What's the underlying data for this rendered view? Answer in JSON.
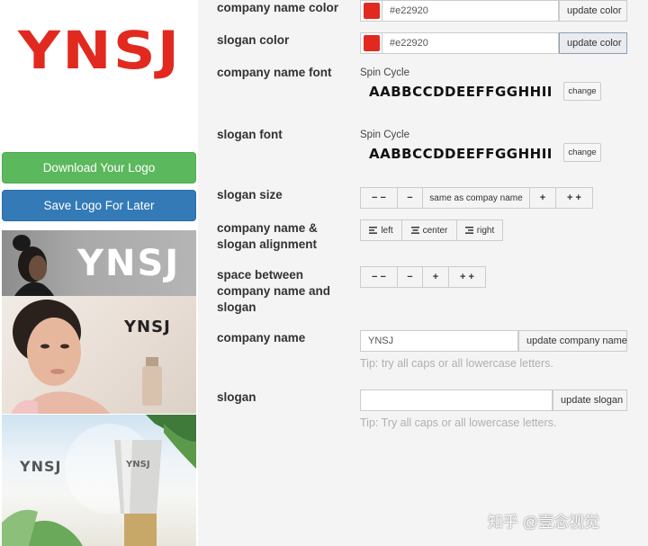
{
  "logo": {
    "text": "YNSJ",
    "color": "#e22920"
  },
  "left_buttons": {
    "download": "Download Your Logo",
    "save": "Save Logo For Later"
  },
  "mockups": [
    {
      "logo_text": "YNSJ"
    },
    {
      "logo_text": "YNSJ"
    },
    {
      "logo_text": "YNSJ",
      "label_text": "YNSJ"
    }
  ],
  "settings": {
    "company_name_color": {
      "label": "company name color",
      "value": "#e22920",
      "button": "update color"
    },
    "slogan_color": {
      "label": "slogan color",
      "value": "#e22920",
      "button": "update color"
    },
    "company_name_font": {
      "label": "company name font",
      "font_name": "Spin Cycle",
      "preview": "AABBCCDDEEFFGGHHII",
      "button": "change"
    },
    "slogan_font": {
      "label": "slogan font",
      "font_name": "Spin Cycle",
      "preview": "AABBCCDDEEFFGGHHII",
      "button": "change"
    },
    "slogan_size": {
      "label": "slogan size",
      "buttons": [
        "− −",
        "−",
        "same as compay name",
        "+",
        "+ +"
      ]
    },
    "alignment": {
      "label_line1": "company name &",
      "label_line2": "slogan alignment",
      "buttons": [
        "left",
        "center",
        "right"
      ]
    },
    "spacing": {
      "label_line1": "space between",
      "label_line2": "company name and",
      "label_line3": "slogan",
      "buttons": [
        "− −",
        "−",
        "+",
        "+ +"
      ]
    },
    "company_name": {
      "label": "company name",
      "value": "YNSJ",
      "button": "update company name",
      "tip": "Tip: try all caps or all lowercase letters."
    },
    "slogan": {
      "label": "slogan",
      "value": "",
      "button": "update slogan",
      "tip": "Tip: Try all caps or all lowercase letters."
    }
  },
  "watermark": "知乎 @壹念视觉",
  "icons": {
    "align_left": "align-left-icon",
    "align_center": "align-center-icon",
    "align_right": "align-right-icon"
  }
}
